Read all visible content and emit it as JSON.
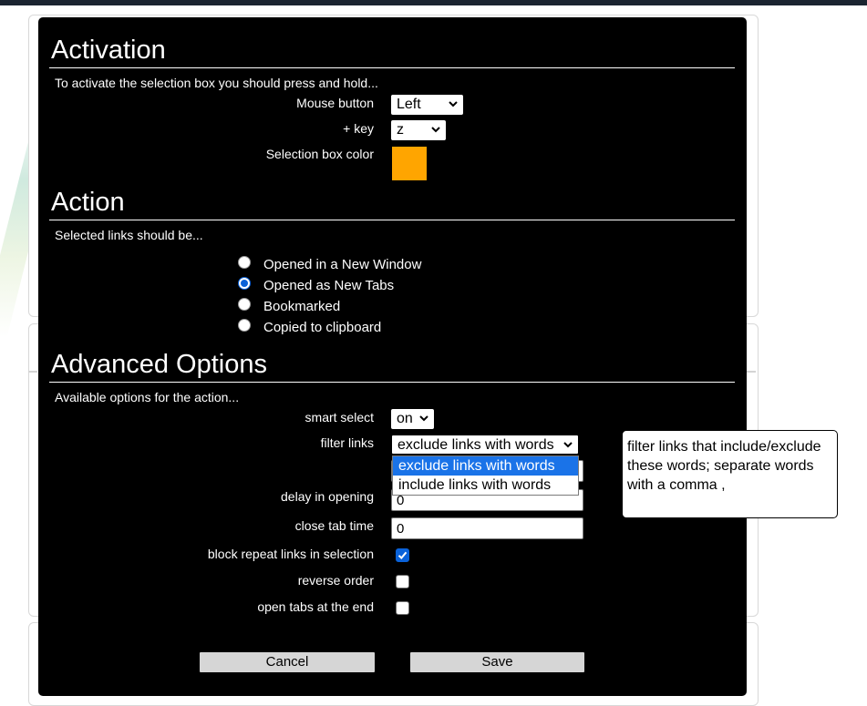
{
  "activation": {
    "title": "Activation",
    "intro": "To activate the selection box you should press and hold...",
    "mouse_button_label": "Mouse button",
    "mouse_button_value": "Left",
    "key_label": "+ key",
    "key_value": "z",
    "color_label": "Selection box color",
    "color_value": "#ffa500"
  },
  "action": {
    "title": "Action",
    "intro": "Selected links should be...",
    "options": [
      {
        "label": "Opened in a New Window",
        "checked": false
      },
      {
        "label": "Opened as New Tabs",
        "checked": true
      },
      {
        "label": "Bookmarked",
        "checked": false
      },
      {
        "label": "Copied to clipboard",
        "checked": false
      }
    ]
  },
  "advanced": {
    "title": "Advanced Options",
    "intro": "Available options for the action...",
    "smart_select_label": "smart select",
    "smart_select_value": "on",
    "filter_links_label": "filter links",
    "filter_links_value": "exclude links with words",
    "filter_options": [
      "exclude links with words",
      "include links with words"
    ],
    "delay_label": "delay in opening",
    "delay_value": "0",
    "close_tab_label": "close tab time",
    "close_tab_value": "0",
    "block_repeat_label": "block repeat links in selection",
    "block_repeat_checked": true,
    "reverse_order_label": "reverse order",
    "reverse_order_checked": false,
    "open_end_label": "open tabs at the end",
    "open_end_checked": false
  },
  "buttons": {
    "cancel": "Cancel",
    "save": "Save"
  },
  "tooltip": {
    "text": "filter links that include/exclude these words; separate words with a comma ,"
  },
  "colors": {
    "dialog_bg": "#000000",
    "accent": "#1a73e8",
    "selection_color": "#ffa500"
  }
}
